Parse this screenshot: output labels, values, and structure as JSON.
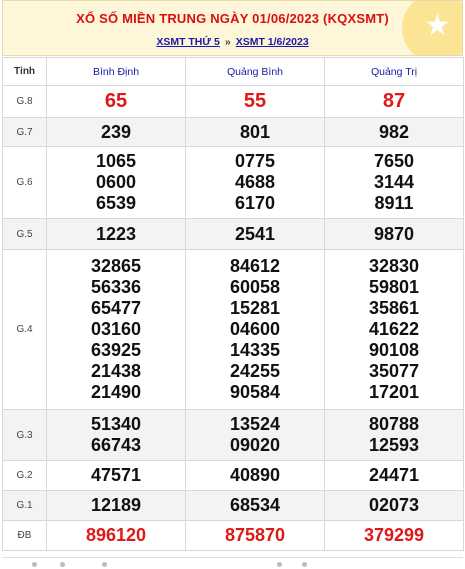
{
  "header": {
    "title": "XỔ SỐ MIỀN TRUNG NGÀY 01/06/2023 (KQXSMT)",
    "link1": "XSMT THỨ 5",
    "separator": "»",
    "link2": "XSMT 1/6/2023"
  },
  "table": {
    "head_label": "Tỉnh",
    "provinces": [
      "Bình Định",
      "Quảng Bình",
      "Quảng Trị"
    ],
    "rows": [
      {
        "label": "G.8",
        "values": [
          [
            "65"
          ],
          [
            "55"
          ],
          [
            "87"
          ]
        ]
      },
      {
        "label": "G.7",
        "values": [
          [
            "239"
          ],
          [
            "801"
          ],
          [
            "982"
          ]
        ]
      },
      {
        "label": "G.6",
        "values": [
          [
            "1065",
            "0600",
            "6539"
          ],
          [
            "0775",
            "4688",
            "6170"
          ],
          [
            "7650",
            "3144",
            "8911"
          ]
        ]
      },
      {
        "label": "G.5",
        "values": [
          [
            "1223"
          ],
          [
            "2541"
          ],
          [
            "9870"
          ]
        ]
      },
      {
        "label": "G.4",
        "values": [
          [
            "32865",
            "56336",
            "65477",
            "03160",
            "63925",
            "21438",
            "21490"
          ],
          [
            "84612",
            "60058",
            "15281",
            "04600",
            "14335",
            "24255",
            "90584"
          ],
          [
            "32830",
            "59801",
            "35861",
            "41622",
            "90108",
            "35077",
            "17201"
          ]
        ]
      },
      {
        "label": "G.3",
        "values": [
          [
            "51340",
            "66743"
          ],
          [
            "13524",
            "09020"
          ],
          [
            "80788",
            "12593"
          ]
        ]
      },
      {
        "label": "G.2",
        "values": [
          [
            "47571"
          ],
          [
            "40890"
          ],
          [
            "24471"
          ]
        ]
      },
      {
        "label": "G.1",
        "values": [
          [
            "12189"
          ],
          [
            "68534"
          ],
          [
            "02073"
          ]
        ]
      },
      {
        "label": "ĐB",
        "values": [
          [
            "896120"
          ],
          [
            "875870"
          ],
          [
            "379299"
          ]
        ]
      }
    ]
  }
}
